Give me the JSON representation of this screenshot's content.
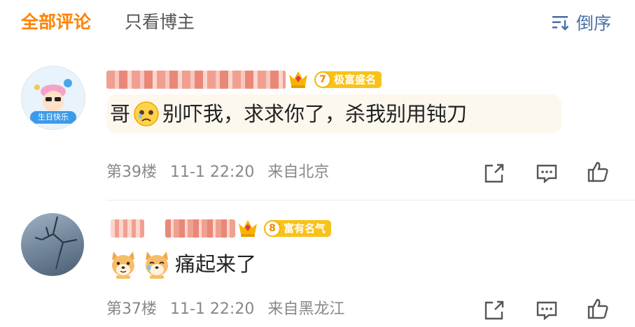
{
  "tabs": {
    "all": "全部评论",
    "author_only": "只看博主"
  },
  "sort": {
    "label": "倒序",
    "icon": "sort-descending-icon"
  },
  "comments": [
    {
      "avatar_text": "生日快乐",
      "level": "7",
      "badge_text": "极富盛名",
      "text_prefix": "哥",
      "text_body": "别吓我，求求你了，杀我别用钝刀",
      "floor": "第39楼",
      "time": "11-1 22:20",
      "location": "来自北京"
    },
    {
      "level": "8",
      "badge_text": "富有名气",
      "text_body": "痛起来了",
      "floor": "第37楼",
      "time": "11-1 22:20",
      "location": "来自黑龙江"
    }
  ],
  "colors": {
    "accent": "#ff8200",
    "sort": "#4a6fa5",
    "badge": "#f8c21b",
    "meta": "#888888",
    "icon": "#555555"
  }
}
